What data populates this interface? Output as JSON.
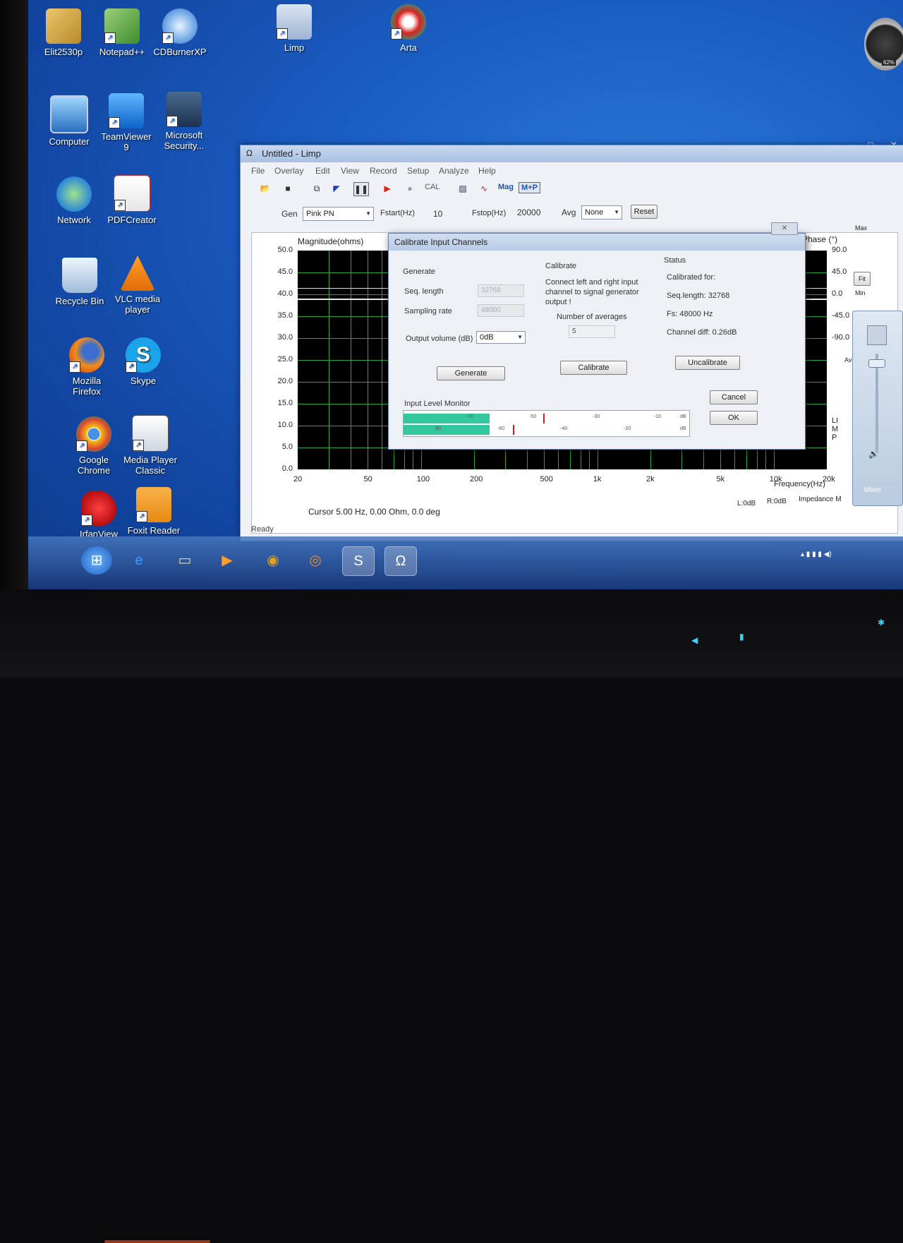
{
  "desktop": {
    "icons": [
      {
        "label": "Elit2530p"
      },
      {
        "label": "Notepad++"
      },
      {
        "label": "CDBurnerXP"
      },
      {
        "label": "Limp"
      },
      {
        "label": "Arta"
      },
      {
        "label": "Computer"
      },
      {
        "label": "TeamViewer\n9"
      },
      {
        "label": "Microsoft\nSecurity..."
      },
      {
        "label": "Network"
      },
      {
        "label": "PDFCreator"
      },
      {
        "label": "Recycle Bin"
      },
      {
        "label": "VLC media\nplayer"
      },
      {
        "label": "Mozilla\nFirefox"
      },
      {
        "label": "Skype"
      },
      {
        "label": "Google\nChrome"
      },
      {
        "label": "Media Player\nClassic"
      },
      {
        "label": "IrfanView"
      },
      {
        "label": "Foxit Reader"
      }
    ],
    "gadget_value": "62%"
  },
  "limp": {
    "title": "Untitled - Limp",
    "menu": [
      "File",
      "Overlay",
      "Edit",
      "View",
      "Record",
      "Setup",
      "Analyze",
      "Help"
    ],
    "toolbar": {
      "cal": "CAL",
      "mag": "Mag",
      "mp": "M+P"
    },
    "gen_label": "Gen",
    "gen_value": "Pink PN",
    "fstart_label": "Fstart(Hz)",
    "fstart_value": "10",
    "fstop_label": "Fstop(Hz)",
    "fstop_value": "20000",
    "avg_label": "Avg",
    "avg_value": "None",
    "reset": "Reset",
    "plot": {
      "magnitude_label": "Magnitude(ohms)",
      "phase_label": "Phase (°)",
      "y_ticks": [
        "50.0",
        "45.0",
        "40.0",
        "35.0",
        "30.0",
        "25.0",
        "20.0",
        "15.0",
        "10.0",
        "5.0",
        "0.0"
      ],
      "x_ticks": [
        "20",
        "50",
        "100",
        "200",
        "500",
        "1k",
        "2k",
        "5k",
        "10k",
        "20k"
      ],
      "phase_ticks": [
        "90.0",
        "45.0",
        "0.0",
        "-45.0",
        "-90.0"
      ],
      "freq_label": "Frequency(Hz)",
      "limp_vertical": "LIMP",
      "cursor": "Cursor  5.00 Hz, 0.00 Ohm, 0.0 deg",
      "l_odb": "L:0dB",
      "r_odb": "R:0dB",
      "impedance": "Impedance M"
    },
    "side": {
      "max": "Max",
      "fit": "Fit",
      "min": "Min",
      "avg": "Avg"
    },
    "status": "Ready"
  },
  "dialog": {
    "title": "Calibrate Input Channels",
    "generate_heading": "Generate",
    "seq_length_label": "Seq. length",
    "seq_length_value": "32768",
    "sampling_rate_label": "Sampling rate",
    "sampling_rate_value": "48000",
    "output_volume_label": "Output volume (dB)",
    "output_volume_value": "0dB",
    "generate_button": "Generate",
    "calibrate_heading": "Calibrate",
    "calibrate_text": "Connect left and right input channel  to  signal generator output !",
    "averages_label": "Number of averages",
    "averages_value": "5",
    "calibrate_button": "Calibrate",
    "status_heading": "Status",
    "calibrated_for": "Calibrated for:",
    "status_seq": "Seq.length: 32768",
    "status_fs": "Fs: 48000 Hz",
    "status_diff": "Channel diff: 0.26dB",
    "uncalibrate_button": "Uncalibrate",
    "cancel_button": "Cancel",
    "ok_button": "OK",
    "monitor_label": "Input Level Monitor",
    "meter_ticks_top": [
      "-70",
      "-50",
      "-30",
      "-10",
      "dB"
    ],
    "meter_ticks_bottom": [
      "-80",
      "-60",
      "-40",
      "-20",
      "dB"
    ],
    "meter_left_level": 0.3,
    "meter_right_level": 0.3
  },
  "mixer": {
    "label": "Mixer"
  }
}
